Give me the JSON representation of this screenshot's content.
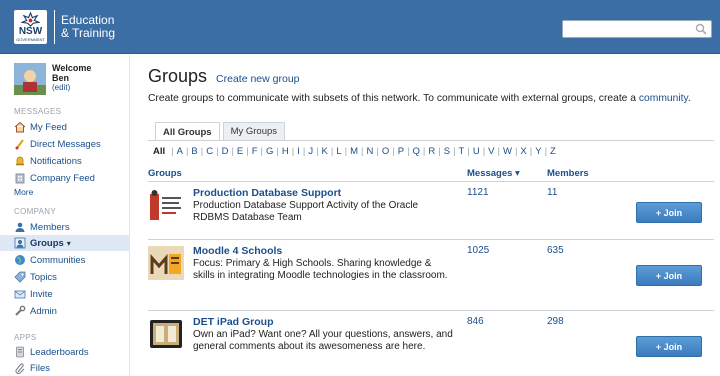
{
  "header": {
    "logo_mark": "NSW",
    "logo_sub": "GOVERNMENT",
    "logo_line1": "Education",
    "logo_line2": "& Training",
    "search_value": ""
  },
  "sidebar": {
    "welcome": "Welcome",
    "user_name": "Ben",
    "edit": "(edit)",
    "sections": {
      "messages": "MESSAGES",
      "company": "COMPANY",
      "apps": "APPS"
    },
    "messages_items": [
      "My Feed",
      "Direct Messages",
      "Notifications",
      "Company Feed"
    ],
    "more": "More",
    "company_items": [
      "Members",
      "Groups",
      "Communities",
      "Topics",
      "Invite",
      "Admin"
    ],
    "groups_arrow": "▾",
    "apps_items": [
      "Leaderboards",
      "Files"
    ]
  },
  "main": {
    "title": "Groups",
    "create_link": "Create new group",
    "intro_prefix": "Create groups to communicate with subsets of this network. To communicate with external groups, create a",
    "intro_link": "community",
    "intro_suffix": ".",
    "tabs": [
      "All Groups",
      "My Groups"
    ],
    "alpha_all": "All",
    "alpha_letters": [
      "A",
      "B",
      "C",
      "D",
      "E",
      "F",
      "G",
      "H",
      "I",
      "J",
      "K",
      "L",
      "M",
      "N",
      "O",
      "P",
      "Q",
      "R",
      "S",
      "T",
      "U",
      "V",
      "W",
      "X",
      "Y",
      "Z"
    ],
    "columns": {
      "groups": "Groups",
      "messages": "Messages ▾",
      "members": "Members"
    },
    "join_label": "+ Join",
    "groups": [
      {
        "name": "Production Database Support",
        "description": "Production Database Support Activity of the Oracle RDBMS Database Team",
        "messages": "1121",
        "members": "11"
      },
      {
        "name": "Moodle 4 Schools",
        "description": "Focus: Primary & High Schools. Sharing knowledge & skills in integrating Moodle technologies in the classroom.",
        "messages": "1025",
        "members": "635"
      },
      {
        "name": "DET iPad Group",
        "description": "Own an iPad? Want one? All your questions, answers, and general comments about its awesomeness are here.",
        "messages": "846",
        "members": "298"
      }
    ]
  },
  "colors": {
    "header": "#3a6ea5",
    "link": "#1a4f8b",
    "join": "#3b7cbf",
    "active_nav": "#dde8f4"
  }
}
